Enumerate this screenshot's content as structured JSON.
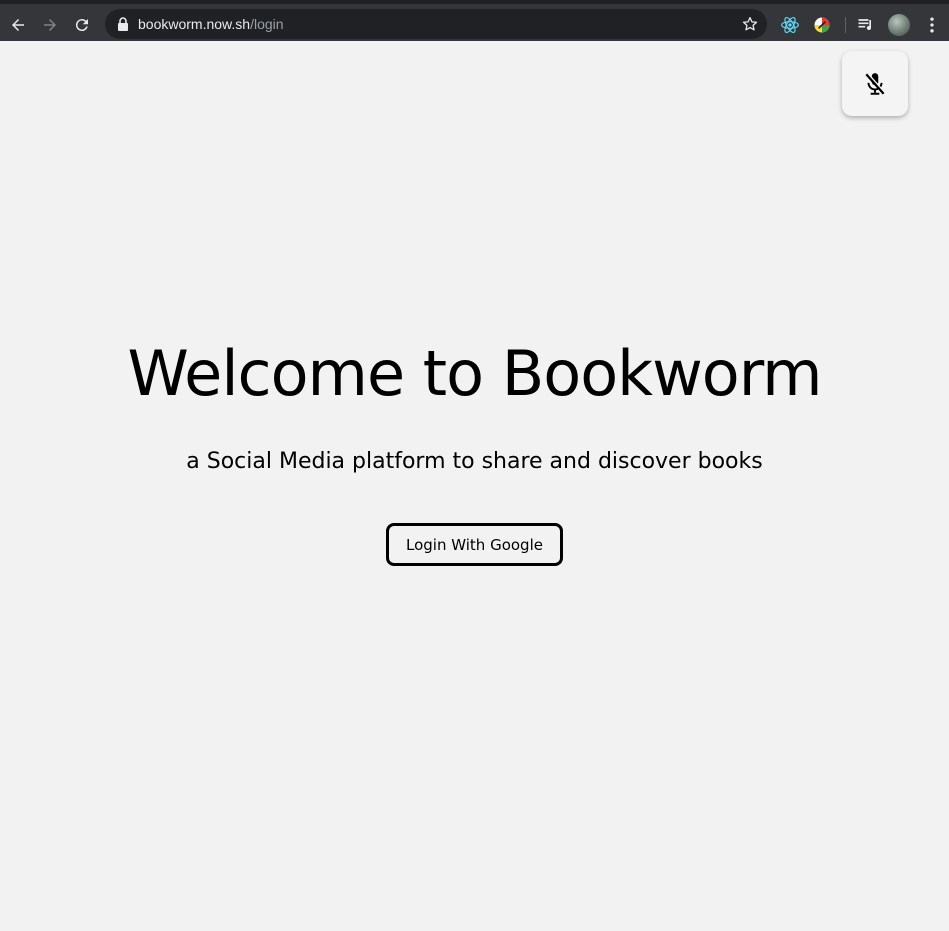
{
  "browser": {
    "url_host": "bookworm.now.sh",
    "url_path": "/login",
    "icons": [
      "back-arrow-icon",
      "forward-arrow-icon",
      "reload-icon",
      "lock-icon",
      "bookmark-star-icon",
      "react-devtools-icon",
      "color-extension-icon",
      "media-queue-icon",
      "profile-avatar",
      "more-menu-icon"
    ]
  },
  "page": {
    "mic_icon": "mic-muted-icon",
    "title": "Welcome to Bookworm",
    "subtitle": "a Social Media platform to share and discover books",
    "login_button": "Login With Google"
  },
  "colors": {
    "background": "#f2f2f2",
    "browser_bar": "#35363a",
    "omnibox": "#202124",
    "text": "#000000"
  }
}
